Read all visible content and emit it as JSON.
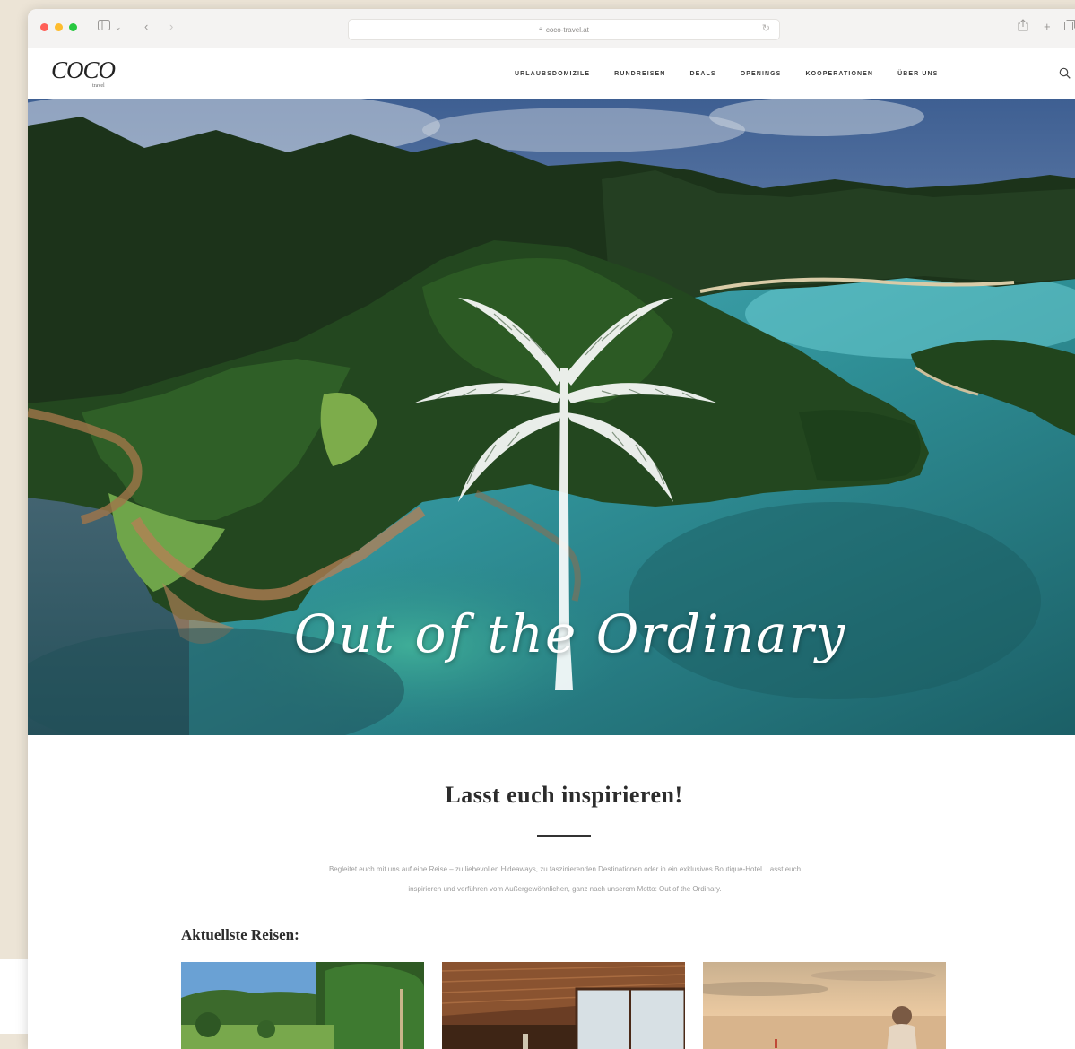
{
  "browser": {
    "url": "coco-travel.at"
  },
  "site": {
    "logo_text": "COCO",
    "logo_sub": "travel"
  },
  "nav": {
    "items": [
      "URLAUBSDOMIZILE",
      "RUNDREISEN",
      "DEALS",
      "OPENINGS",
      "KOOPERATIONEN",
      "ÜBER UNS"
    ]
  },
  "hero": {
    "tagline": "Out of the Ordinary"
  },
  "intro": {
    "title": "Lasst euch inspirieren!",
    "text_line1": "Begleitet euch mit uns auf eine Reise – zu liebevollen Hideaways, zu faszinierenden Destinationen oder in ein exklusives Boutique-Hotel. Lasst euch",
    "text_line2": "inspirieren und verführen vom Außergewöhnlichen, ganz nach unserem Motto: Out of the Ordinary."
  },
  "latest": {
    "title": "Aktuellste Reisen:"
  },
  "colors": {
    "page_bg": "#ece4d6",
    "sea": "#2f8f96",
    "forest": "#1f3a1c"
  }
}
